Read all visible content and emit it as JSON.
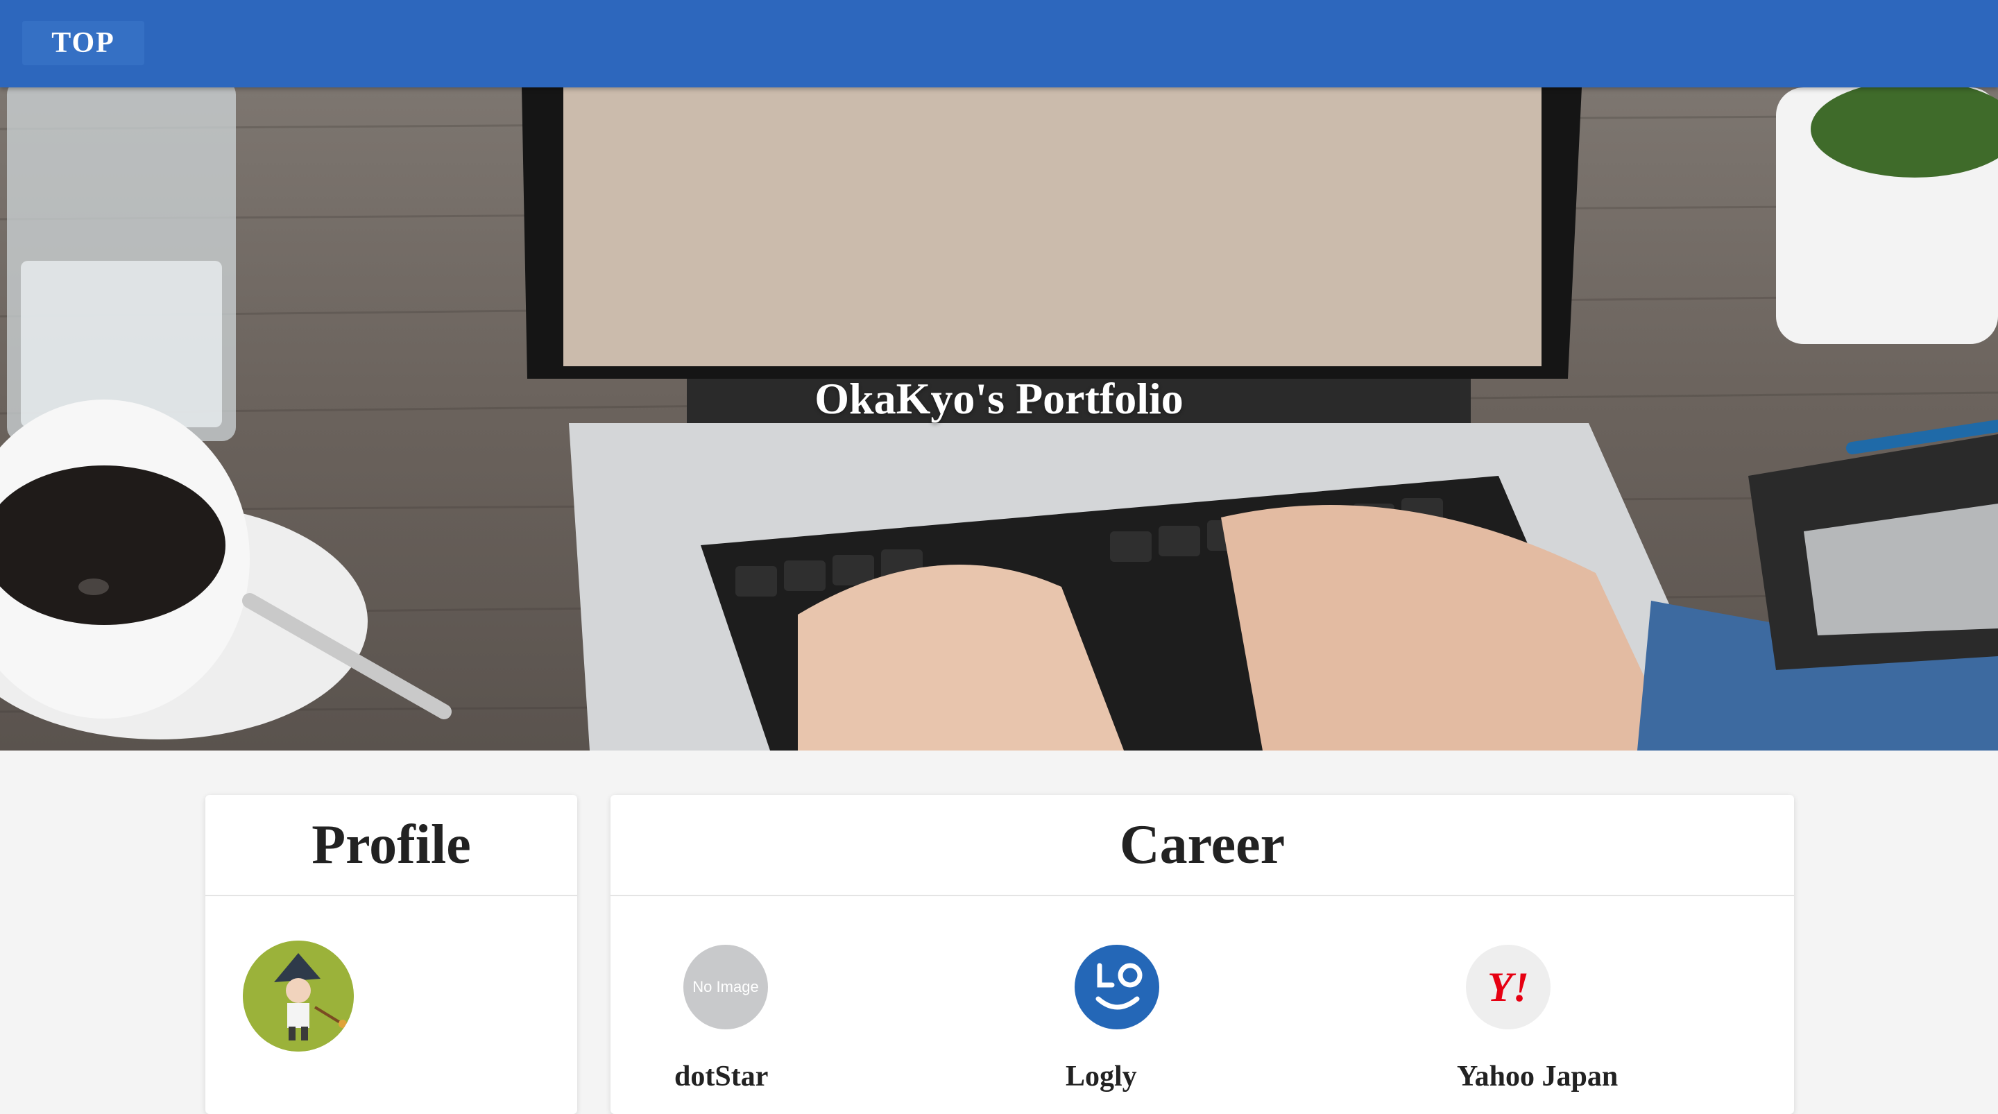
{
  "header": {
    "top_label": "TOP"
  },
  "hero": {
    "title": "OkaKyo's Portfolio"
  },
  "profile": {
    "heading": "Profile"
  },
  "career": {
    "heading": "Career",
    "companies": [
      {
        "name": "dotStar",
        "logo_text": "No Image"
      },
      {
        "name": "Logly",
        "logo_text": ""
      },
      {
        "name": "Yahoo Japan",
        "logo_text": "Y!"
      }
    ]
  },
  "colors": {
    "header": "#2d67bd",
    "yahoo_red": "#e60012",
    "logly_blue": "#2467b7"
  }
}
